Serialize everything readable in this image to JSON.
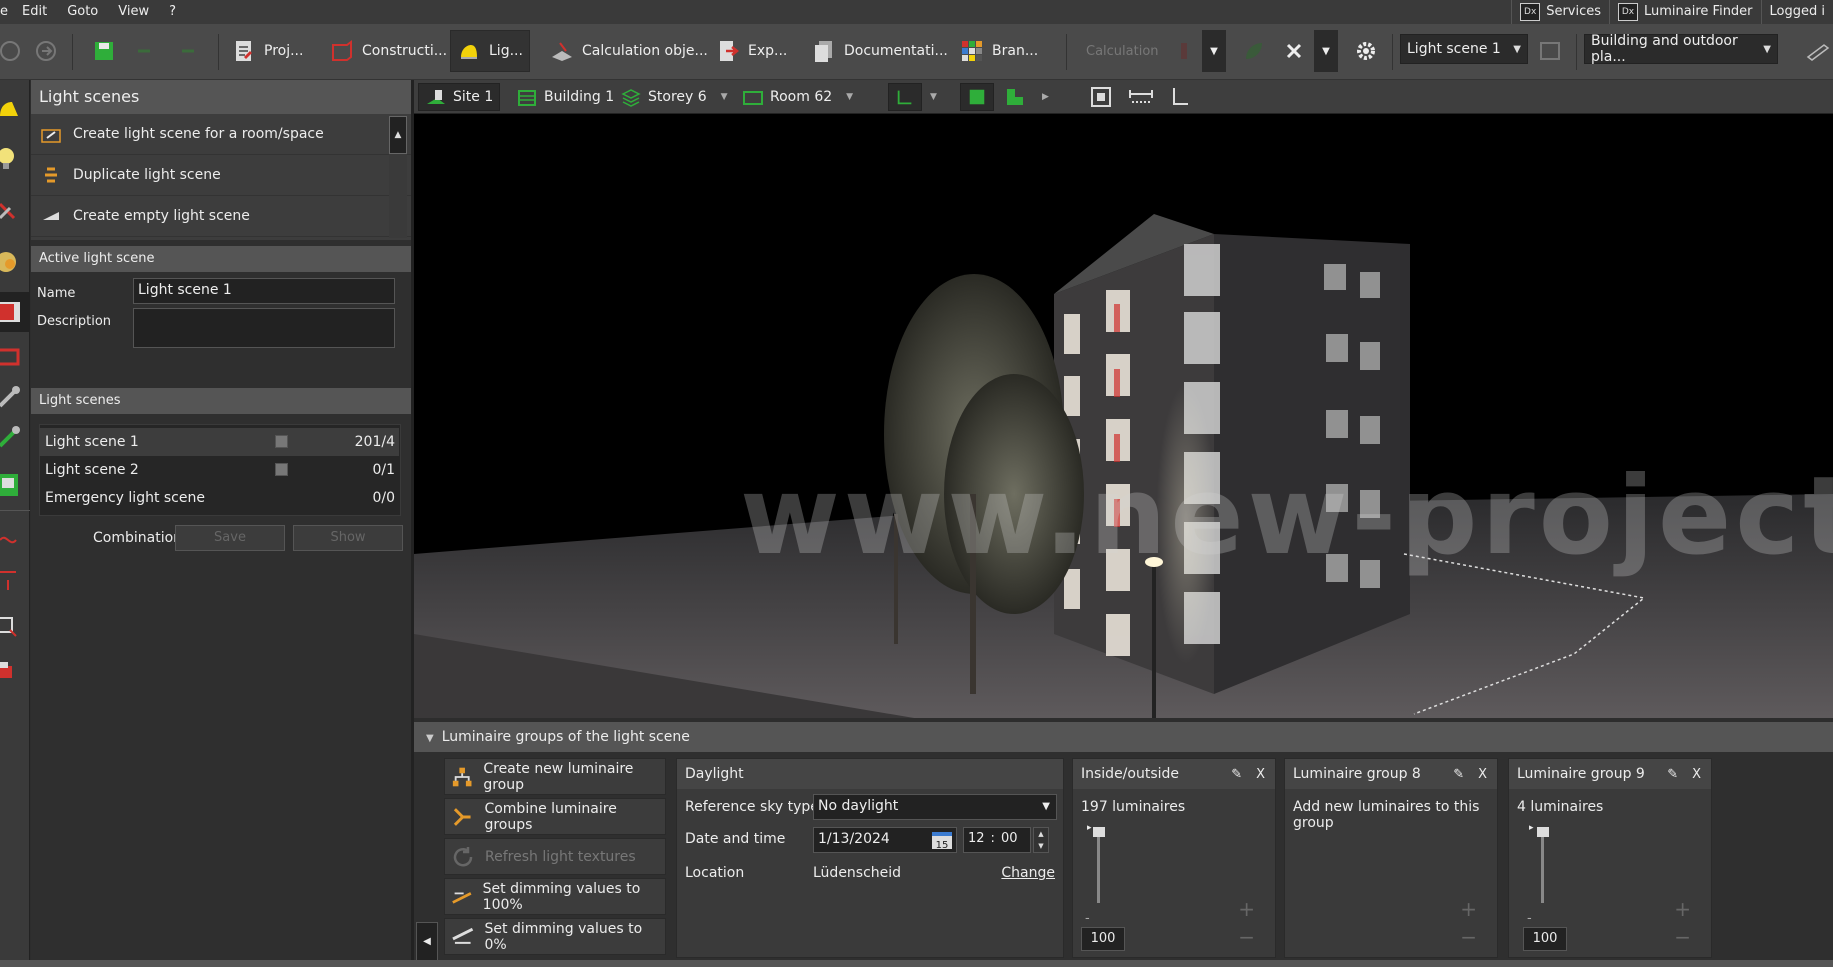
{
  "menu": {
    "items": [
      "e",
      "Edit",
      "Goto",
      "View",
      "?"
    ],
    "services": "Services",
    "luminaire_finder": "Luminaire Finder",
    "logged_in": "Logged i",
    "dx": "Dx"
  },
  "toolbar": {
    "tabs": [
      {
        "label": "Proj..."
      },
      {
        "label": "Constructi..."
      },
      {
        "label": "Lig..."
      },
      {
        "label": "Calculation obje..."
      },
      {
        "label": "Exp..."
      },
      {
        "label": "Documentati..."
      },
      {
        "label": "Bran..."
      }
    ],
    "calculation": "Calculation",
    "light_scene_combo": "Light scene 1",
    "view_combo": "Building and outdoor pla..."
  },
  "left_panel": {
    "title": "Light scenes",
    "actions": [
      "Create light scene for a room/space",
      "Duplicate light scene",
      "Create empty light scene"
    ],
    "active_header": "Active light scene",
    "name_label": "Name",
    "name_value": "Light scene 1",
    "description_label": "Description",
    "description_value": "",
    "scenes_header": "Light scenes",
    "scenes": [
      {
        "name": "Light scene 1",
        "count": "201/4",
        "checkbox": true
      },
      {
        "name": "Light scene 2",
        "count": "0/1",
        "checkbox": true
      },
      {
        "name": "Emergency light scene",
        "count": "0/0",
        "checkbox": false
      }
    ],
    "combination_label": "Combination",
    "save_label": "Save",
    "show_label": "Show"
  },
  "view_toolbar": {
    "site": "Site 1",
    "building": "Building 1",
    "storey": "Storey 6",
    "room": "Room 62"
  },
  "watermark": "www.new-project.ir",
  "lg": {
    "header": "Luminaire groups of the light scene",
    "buttons": [
      {
        "label": "Create new luminaire group",
        "disabled": false
      },
      {
        "label": "Combine luminaire groups",
        "disabled": false
      },
      {
        "label": "Refresh light textures",
        "disabled": true
      },
      {
        "label": "Set dimming values to 100%",
        "disabled": false
      },
      {
        "label": "Set dimming values to 0%",
        "disabled": false
      }
    ],
    "daylight": {
      "title": "Daylight",
      "sky_label": "Reference sky type",
      "sky_value": "No daylight",
      "date_label": "Date and time",
      "date_value": "1/13/2024",
      "cal_day": "15",
      "hour": "12",
      "minute": "00",
      "location_label": "Location",
      "location_value": "Lüdenscheid",
      "change_label": "Change"
    },
    "groups": [
      {
        "title": "Inside/outside",
        "info": "197 luminaires",
        "value": "100",
        "has_slider": true
      },
      {
        "title": "Luminaire group 8",
        "info": "Add new luminaires to this group",
        "value": "",
        "has_slider": false
      },
      {
        "title": "Luminaire group 9",
        "info": "4 luminaires",
        "value": "100",
        "has_slider": true
      }
    ]
  },
  "colors": {
    "accent_green": "#2fae3a",
    "accent_orange": "#e59a2a",
    "accent_red": "#d0312d"
  }
}
